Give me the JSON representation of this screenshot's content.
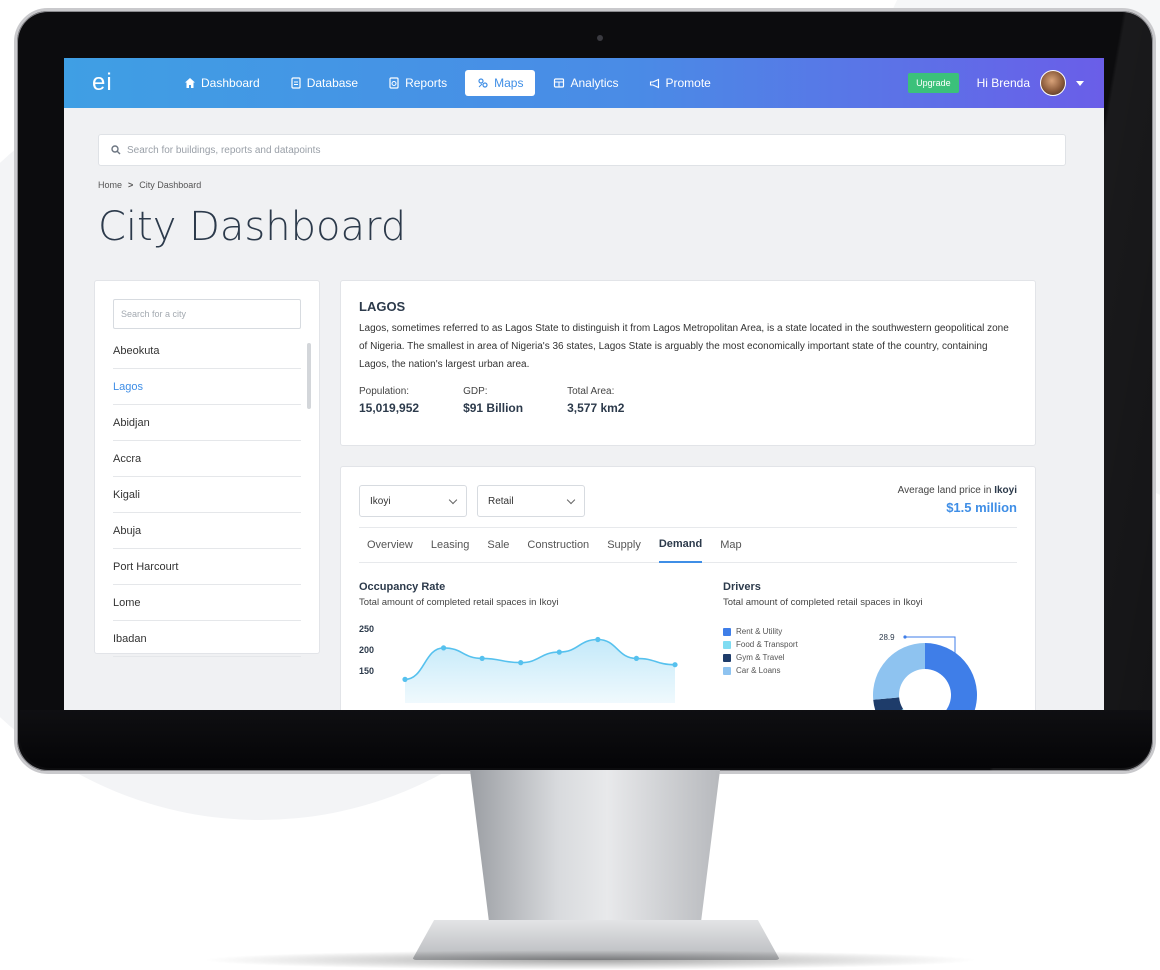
{
  "app": {
    "logo": "ei",
    "nav": [
      {
        "label": "Dashboard",
        "icon": "home-icon",
        "active": false
      },
      {
        "label": "Database",
        "icon": "document-icon",
        "active": false
      },
      {
        "label": "Reports",
        "icon": "report-icon",
        "active": false
      },
      {
        "label": "Maps",
        "icon": "map-icon",
        "active": true
      },
      {
        "label": "Analytics",
        "icon": "analytics-icon",
        "active": false
      },
      {
        "label": "Promote",
        "icon": "megaphone-icon",
        "active": false
      }
    ],
    "upgrade_label": "Upgrade",
    "greeting": "Hi Brenda"
  },
  "search": {
    "placeholder": "Search for buildings, reports and datapoints"
  },
  "breadcrumb": {
    "home": "Home",
    "separator": ">",
    "current": "City Dashboard"
  },
  "page_title": "City Dashboard",
  "city_panel": {
    "search_placeholder": "Search for a city",
    "cities": [
      "Abeokuta",
      "Lagos",
      "Abidjan",
      "Accra",
      "Kigali",
      "Abuja",
      "Port Harcourt",
      "Lome",
      "Ibadan"
    ],
    "active_city": "Lagos"
  },
  "info": {
    "title": "LAGOS",
    "description": "Lagos, sometimes referred to as Lagos State to distinguish it from Lagos Metropolitan Area, is a state located in the southwestern geopolitical zone of Nigeria. The smallest in area of Nigeria's 36 states, Lagos State is arguably the most economically important state of the country, containing Lagos, the nation's largest urban area.",
    "stats": [
      {
        "label": "Population:",
        "value": "15,019,952"
      },
      {
        "label": "GDP:",
        "value": "$91 Billion"
      },
      {
        "label": "Total Area:",
        "value": "3,577 km2"
      }
    ]
  },
  "filters": {
    "area": "Ikoyi",
    "category": "Retail"
  },
  "land_price": {
    "label": "Average land price in",
    "area": "Ikoyi",
    "value": "$1.5 million"
  },
  "tabs": [
    "Overview",
    "Leasing",
    "Sale",
    "Construction",
    "Supply",
    "Demand",
    "Map"
  ],
  "active_tab": "Demand",
  "occupancy": {
    "title": "Occupancy Rate",
    "subtitle": "Total amount of completed retail spaces in Ikoyi"
  },
  "drivers": {
    "title": "Drivers",
    "subtitle": "Total amount of completed retail spaces in Ikoyi"
  },
  "chart_data": [
    {
      "type": "area",
      "title": "Occupancy Rate",
      "y_ticks": [
        "250",
        "200",
        "150"
      ],
      "ylim": [
        100,
        250
      ],
      "x": [
        1,
        2,
        3,
        4,
        5,
        6,
        7,
        8
      ],
      "values": [
        130,
        205,
        180,
        170,
        195,
        225,
        180,
        165
      ],
      "color": "#56c1ee"
    },
    {
      "type": "pie",
      "title": "Drivers",
      "categories": [
        "Rent & Utility",
        "Food & Transport",
        "Gym & Travel",
        "Car & Loans"
      ],
      "colors": [
        "#3f7ee8",
        "#7fdcf2",
        "#1e3c6a",
        "#8ec3f0"
      ],
      "values": [
        28.9,
        6,
        4,
        14
      ],
      "callout": "28.9"
    }
  ]
}
